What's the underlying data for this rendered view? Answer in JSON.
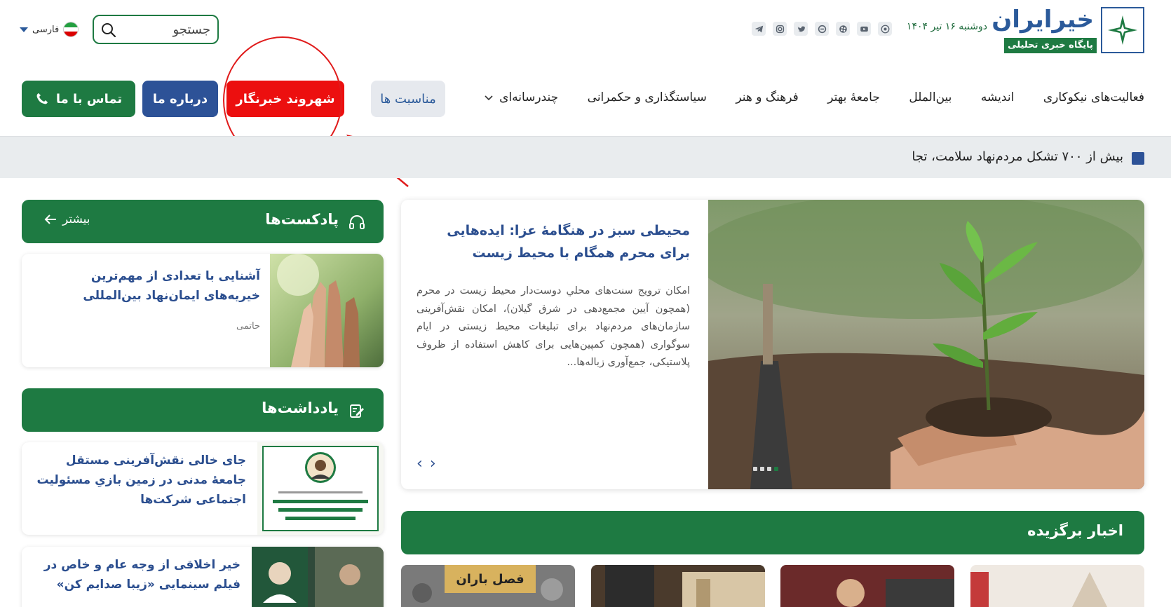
{
  "header": {
    "logo_title": "خیرایران",
    "logo_subtitle": "پایگاه خبری تحلیلی",
    "date": "دوشنبه ۱۶ تیر ۱۴۰۴",
    "social_icons": [
      "telegram-icon",
      "instagram-icon",
      "twitter-icon",
      "eitaa-icon",
      "aparat-icon",
      "youtube-icon",
      "rubika-icon"
    ],
    "search_placeholder": "جستجو",
    "language_label": "فارسی"
  },
  "nav": {
    "items": [
      "فعالیت‌های نیکوکاری",
      "اندیشه",
      "بین‌الملل",
      "جامعهٔ بهتر",
      "فرهنگ و هنر",
      "سیاستگذاری و حکمرانی",
      "چندرسانه‌ای"
    ],
    "occasions": "مناسبت ها",
    "citizen_reporter": "شهروند خبرنگار",
    "about": "درباره ما",
    "contact": "تماس با ما"
  },
  "ticker": {
    "text": "بیش از ۷۰۰ تشکل مردم‌نهاد سلامت، تجا"
  },
  "podcasts": {
    "title": "پادکست‌ها",
    "more": "بیشتر",
    "item": {
      "title": "آشنایی با تعدادی از مهم‌ترین خیریه‌های ایمان‌نهاد بین‌المللی",
      "author": "حاتمی"
    }
  },
  "notes": {
    "title": "یادداشت‌ها",
    "items": [
      {
        "title": "جای خالی نقش‌آفرینی مستقل جامعهٔ مدنی در زمین بازیِ مسئولیت اجتماعی شرکت‌ها"
      },
      {
        "title": "خیر اخلاقی از وجه عام و خاص در فیلم سینمایی «زیبا صدایم کن»"
      }
    ]
  },
  "feature": {
    "title": "محیطی سبز در هنگامهٔ عزا: ایده‌هایی برای محرم همگام با محیط زیست",
    "excerpt": "امکان ترویج سنت‌های محلي دوست‌دار محیط زیست در محرم (همچون آیین مجمع‌دهی در شرق گیلان)، امکان نقش‌آفرینی سازمان‌های مردم‌نهاد برای تبلیغات محیط زیستی در ایام سوگواری (همچون کمپین‌هایی برای کاهش استفاده از ظروف پلاستیکی، جمع‌آوری زباله‌ها...",
    "slide_count": 4,
    "active_slide": 4
  },
  "featured_news": {
    "title": "اخبار برگزیده",
    "thumb1_label": "فصل باران"
  },
  "colors": {
    "brand_green": "#1e7a42",
    "brand_blue": "#2d5297",
    "highlight_red": "#ec0f0f"
  }
}
